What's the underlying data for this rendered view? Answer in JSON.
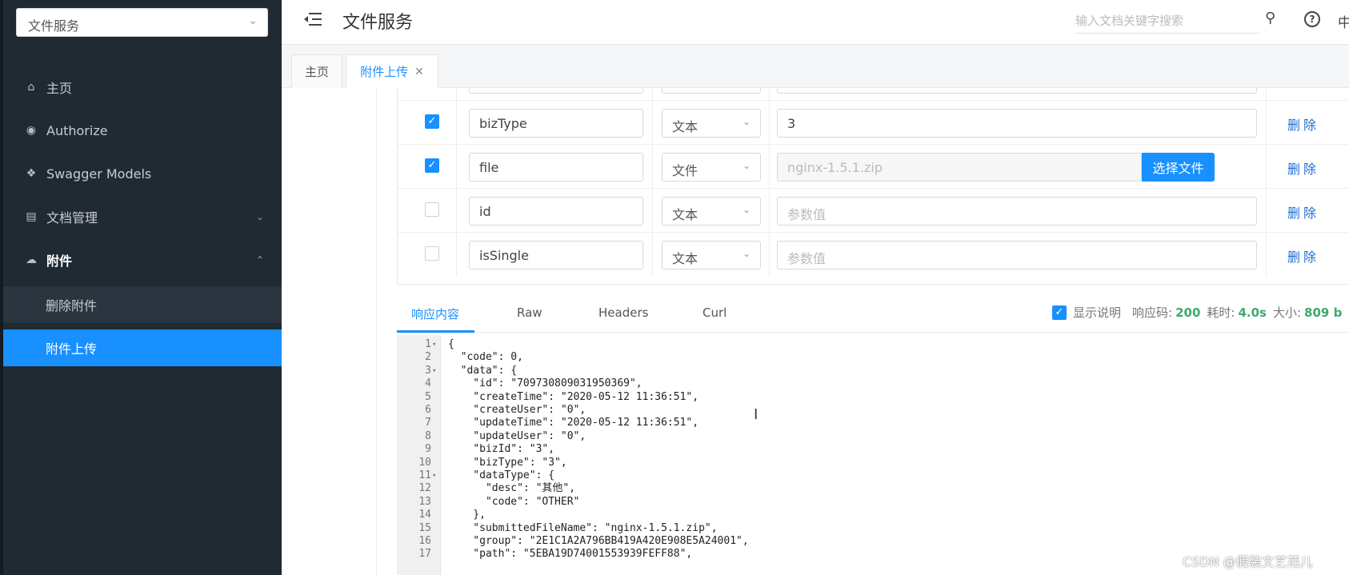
{
  "sidebar": {
    "service_select": "文件服务",
    "items": [
      {
        "label": "主页",
        "icon": "home-icon"
      },
      {
        "label": "Authorize",
        "icon": "lock-icon"
      },
      {
        "label": "Swagger Models",
        "icon": "cube-icon"
      },
      {
        "label": "文档管理",
        "icon": "document-icon"
      },
      {
        "label": "附件",
        "icon": "cloud-icon"
      }
    ],
    "sub_items": [
      {
        "label": "删除附件"
      },
      {
        "label": "附件上传"
      }
    ]
  },
  "header": {
    "title": "文件服务",
    "search_placeholder": "输入文档关键字搜索",
    "lang": "中"
  },
  "tabs": [
    {
      "label": "主页"
    },
    {
      "label": "附件上传"
    }
  ],
  "params": {
    "rows": [
      {
        "checked": true,
        "name": "bizType",
        "type": "文本",
        "value": "3"
      },
      {
        "checked": true,
        "name": "file",
        "type": "文件",
        "value": "nginx-1.5.1.zip"
      },
      {
        "checked": false,
        "name": "id",
        "type": "文本",
        "value": "参数值"
      },
      {
        "checked": false,
        "name": "isSingle",
        "type": "文本",
        "value": "参数值"
      }
    ],
    "file_button_label": "选择文件",
    "delete_label": "删除"
  },
  "response": {
    "tabs": [
      "响应内容",
      "Raw",
      "Headers",
      "Curl"
    ],
    "show_desc_label": "显示说明",
    "status_label": "响应码:",
    "status_value": "200",
    "time_label": "耗时:",
    "time_value": "4.0s",
    "size_label": "大小:",
    "size_value": "809 b",
    "lines": [
      {
        "n": "1",
        "fold": true,
        "text": "{"
      },
      {
        "n": "2",
        "fold": false,
        "text": "  \"code\": 0,"
      },
      {
        "n": "3",
        "fold": true,
        "text": "  \"data\": {"
      },
      {
        "n": "4",
        "fold": false,
        "text": "    \"id\": \"709730809031950369\","
      },
      {
        "n": "5",
        "fold": false,
        "text": "    \"createTime\": \"2020-05-12 11:36:51\","
      },
      {
        "n": "6",
        "fold": false,
        "text": "    \"createUser\": \"0\","
      },
      {
        "n": "7",
        "fold": false,
        "text": "    \"updateTime\": \"2020-05-12 11:36:51\","
      },
      {
        "n": "8",
        "fold": false,
        "text": "    \"updateUser\": \"0\","
      },
      {
        "n": "9",
        "fold": false,
        "text": "    \"bizId\": \"3\","
      },
      {
        "n": "10",
        "fold": false,
        "text": "    \"bizType\": \"3\","
      },
      {
        "n": "11",
        "fold": true,
        "text": "    \"dataType\": {"
      },
      {
        "n": "12",
        "fold": false,
        "text": "      \"desc\": \"其他\","
      },
      {
        "n": "13",
        "fold": false,
        "text": "      \"code\": \"OTHER\""
      },
      {
        "n": "14",
        "fold": false,
        "text": "    },"
      },
      {
        "n": "15",
        "fold": false,
        "text": "    \"submittedFileName\": \"nginx-1.5.1.zip\","
      },
      {
        "n": "16",
        "fold": false,
        "text": "    \"group\": \"2E1C1A2A796BB419A420E908E5A24001\","
      },
      {
        "n": "17",
        "fold": false,
        "text": "    \"path\": \"5EBA19D74001553939FEFF88\","
      }
    ]
  },
  "watermark": "CSDN @假装文艺范儿",
  "colors": {
    "accent": "#1890ff",
    "sidebar_bg": "#202a33",
    "success": "#3caa6e"
  }
}
